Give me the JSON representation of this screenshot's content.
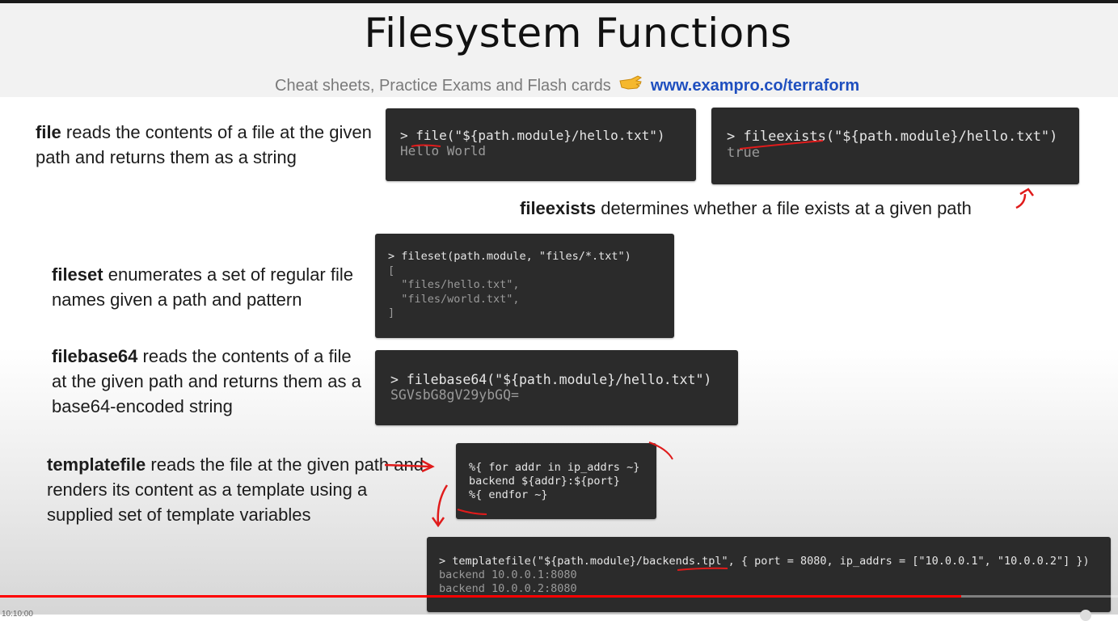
{
  "header": {
    "title": "Filesystem Functions",
    "subtitle": "Cheat sheets, Practice Exams and Flash cards",
    "link": "www.exampro.co/terraform",
    "pointer_icon": "pointing-hand-icon"
  },
  "file": {
    "name": "file",
    "desc": "reads the contents of a file at the given path and returns them as a string",
    "code": "> file(\"${path.module}/hello.txt\")",
    "output": "Hello World"
  },
  "fileexists": {
    "name": "fileexists",
    "desc": "determines whether a file exists at a given path",
    "code": "> fileexists(\"${path.module}/hello.txt\")",
    "output": "true"
  },
  "fileset": {
    "name": "fileset",
    "desc": "enumerates a set of regular file names given a path and pattern",
    "code_lines": [
      "> fileset(path.module, \"files/*.txt\")",
      "[",
      "  \"files/hello.txt\",",
      "  \"files/world.txt\",",
      "]"
    ]
  },
  "filebase64": {
    "name": "filebase64",
    "desc": "reads the contents of a file at the given path and returns them as a base64-encoded string",
    "code": "> filebase64(\"${path.module}/hello.txt\")",
    "output": "SGVsbG8gV29ybGQ="
  },
  "templatefile": {
    "name": "templatefile",
    "desc": "reads the file at the given path and renders its content as a template using a supplied set of template variables",
    "template_lines": [
      "%{ for addr in ip_addrs ~}",
      "backend ${addr}:${port}",
      "%{ endfor ~}"
    ],
    "call": "> templatefile(\"${path.module}/backends.tpl\", { port = 8080, ip_addrs = [\"10.0.0.1\", \"10.0.0.2\"] })",
    "output_lines": [
      "backend 10.0.0.1:8080",
      "backend 10.0.0.2:8080"
    ]
  },
  "player": {
    "progress": 0.86,
    "timecode": "10:10:00"
  },
  "colors": {
    "code_bg": "#2b2b2b",
    "string": "#e6db74",
    "keyword": "#a6e22e",
    "number": "#ae81ff",
    "annotation": "#e01b1b",
    "progress": "#ff0000"
  }
}
